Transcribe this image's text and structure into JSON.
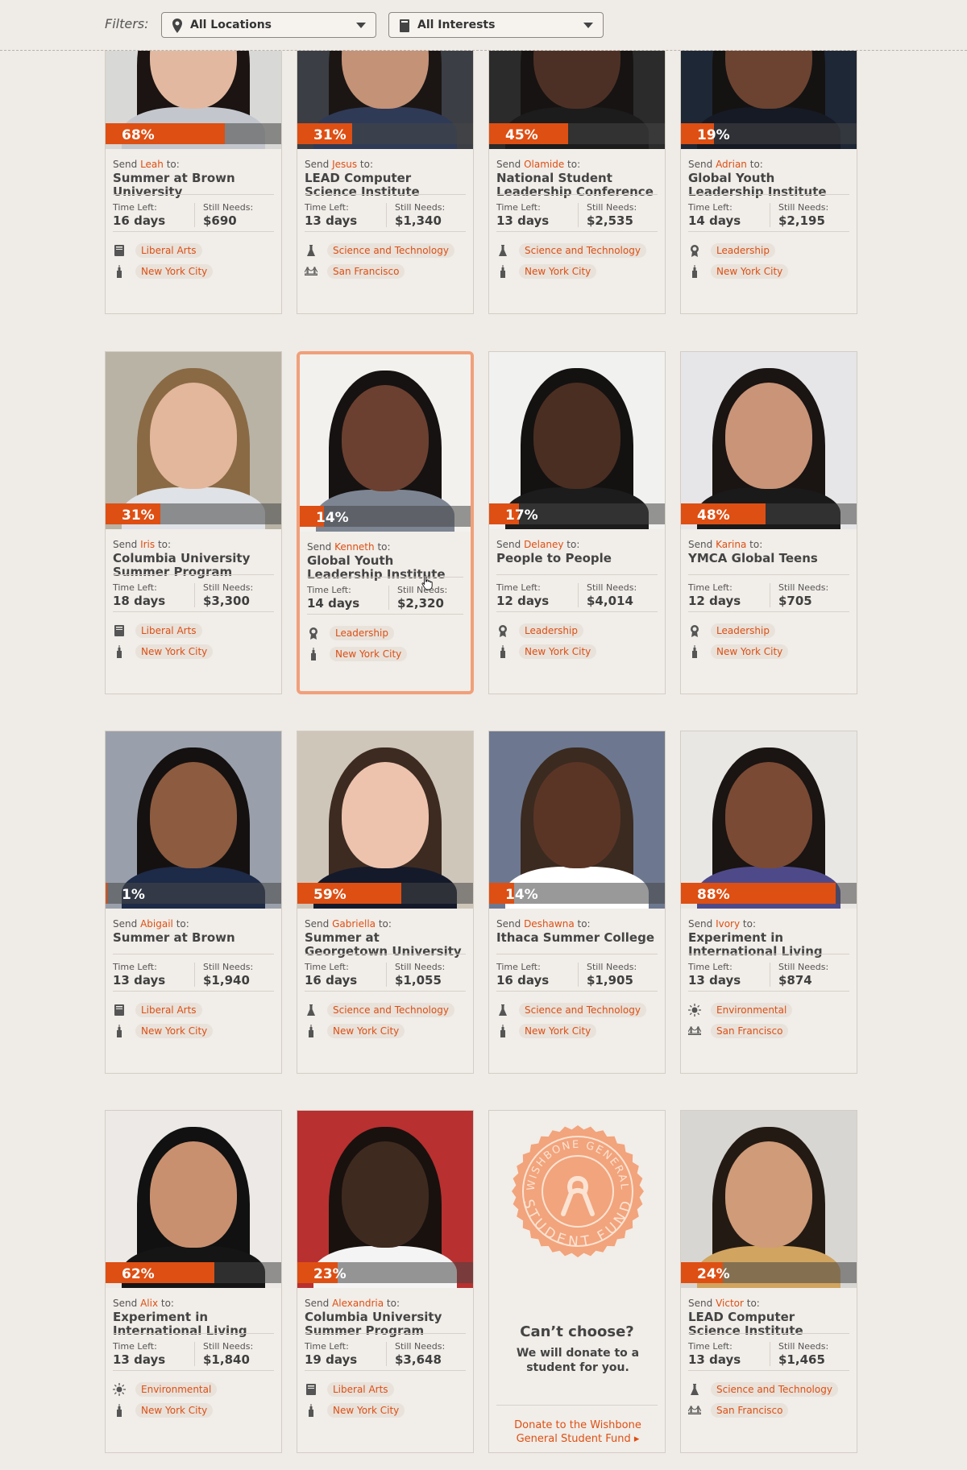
{
  "filters": {
    "label": "Filters:",
    "location": "All Locations",
    "interest": "All Interests"
  },
  "colors": {
    "accent": "#de4f13",
    "background": "#efebe6",
    "highlight_border": "#f0a07a"
  },
  "labels": {
    "send": "Send",
    "to": "to:",
    "time_left": "Time Left:",
    "still_needs": "Still Needs:"
  },
  "cards": [
    {
      "pct": "68%",
      "progress": 0.68,
      "name": "Leah",
      "program": "Summer at Brown University",
      "time_left": "16 days",
      "still_needs": "$690",
      "interest": "Liberal Arts",
      "interest_icon": "book-icon",
      "location": "New York City",
      "location_icon": "empire-state-icon"
    },
    {
      "pct": "31%",
      "progress": 0.31,
      "name": "Jesus",
      "program": "LEAD Computer Science Institute",
      "time_left": "13 days",
      "still_needs": "$1,340",
      "interest": "Science and Technology",
      "interest_icon": "flask-icon",
      "location": "San Francisco",
      "location_icon": "golden-gate-icon"
    },
    {
      "pct": "45%",
      "progress": 0.45,
      "name": "Olamide",
      "program": "National Student Leadership Conference",
      "time_left": "13 days",
      "still_needs": "$2,535",
      "interest": "Science and Technology",
      "interest_icon": "flask-icon",
      "location": "New York City",
      "location_icon": "empire-state-icon"
    },
    {
      "pct": "19%",
      "progress": 0.19,
      "name": "Adrian",
      "program": "Global Youth Leadership Institute",
      "time_left": "14 days",
      "still_needs": "$2,195",
      "interest": "Leadership",
      "interest_icon": "ribbon-icon",
      "location": "New York City",
      "location_icon": "empire-state-icon"
    },
    {
      "pct": "31%",
      "progress": 0.31,
      "name": "Iris",
      "program": "Columbia University Summer Program",
      "time_left": "18 days",
      "still_needs": "$3,300",
      "interest": "Liberal Arts",
      "interest_icon": "book-icon",
      "location": "New York City",
      "location_icon": "empire-state-icon"
    },
    {
      "pct": "14%",
      "progress": 0.14,
      "name": "Kenneth",
      "program": "Global Youth Leadership Institute",
      "time_left": "14 days",
      "still_needs": "$2,320",
      "interest": "Leadership",
      "interest_icon": "ribbon-icon",
      "location": "New York City",
      "location_icon": "empire-state-icon",
      "highlighted": true
    },
    {
      "pct": "17%",
      "progress": 0.17,
      "name": "Delaney",
      "program": "People to People",
      "time_left": "12 days",
      "still_needs": "$4,014",
      "interest": "Leadership",
      "interest_icon": "ribbon-icon",
      "location": "New York City",
      "location_icon": "empire-state-icon"
    },
    {
      "pct": "48%",
      "progress": 0.48,
      "name": "Karina",
      "program": "YMCA Global Teens",
      "time_left": "12 days",
      "still_needs": "$705",
      "interest": "Leadership",
      "interest_icon": "ribbon-icon",
      "location": "New York City",
      "location_icon": "empire-state-icon"
    },
    {
      "pct": "1%",
      "progress": 0.01,
      "name": "Abigail",
      "program": "Summer at Brown",
      "time_left": "13 days",
      "still_needs": "$1,940",
      "interest": "Liberal Arts",
      "interest_icon": "book-icon",
      "location": "New York City",
      "location_icon": "empire-state-icon"
    },
    {
      "pct": "59%",
      "progress": 0.59,
      "name": "Gabriella",
      "program": "Summer at Georgetown University",
      "time_left": "16 days",
      "still_needs": "$1,055",
      "interest": "Science and Technology",
      "interest_icon": "flask-icon",
      "location": "New York City",
      "location_icon": "empire-state-icon"
    },
    {
      "pct": "14%",
      "progress": 0.14,
      "name": "Deshawna",
      "program": "Ithaca Summer College",
      "time_left": "16 days",
      "still_needs": "$1,905",
      "interest": "Science and Technology",
      "interest_icon": "flask-icon",
      "location": "New York City",
      "location_icon": "empire-state-icon"
    },
    {
      "pct": "88%",
      "progress": 0.88,
      "name": "Ivory",
      "program": "Experiment in International Living",
      "time_left": "13 days",
      "still_needs": "$874",
      "interest": "Environmental",
      "interest_icon": "sun-icon",
      "location": "San Francisco",
      "location_icon": "golden-gate-icon"
    },
    {
      "pct": "62%",
      "progress": 0.62,
      "name": "Alix",
      "program": "Experiment in International Living",
      "time_left": "13 days",
      "still_needs": "$1,840",
      "interest": "Environmental",
      "interest_icon": "sun-icon",
      "location": "New York City",
      "location_icon": "empire-state-icon"
    },
    {
      "pct": "23%",
      "progress": 0.23,
      "name": "Alexandria",
      "program": "Columbia University Summer Program",
      "time_left": "19 days",
      "still_needs": "$3,648",
      "interest": "Liberal Arts",
      "interest_icon": "book-icon",
      "location": "New York City",
      "location_icon": "empire-state-icon"
    },
    {
      "promo": true,
      "seal_top": "WISHBONE GENERAL",
      "seal_bottom": "STUDENT FUND",
      "question": "Can’t choose?",
      "description": "We will donate to a student for you.",
      "link": "Donate to the Wishbone General Student Fund ▸"
    },
    {
      "pct": "24%",
      "progress": 0.24,
      "name": "Victor",
      "program": "LEAD Computer Science Institute",
      "time_left": "13 days",
      "still_needs": "$1,465",
      "interest": "Science and Technology",
      "interest_icon": "flask-icon",
      "location": "San Francisco",
      "location_icon": "golden-gate-icon"
    }
  ]
}
